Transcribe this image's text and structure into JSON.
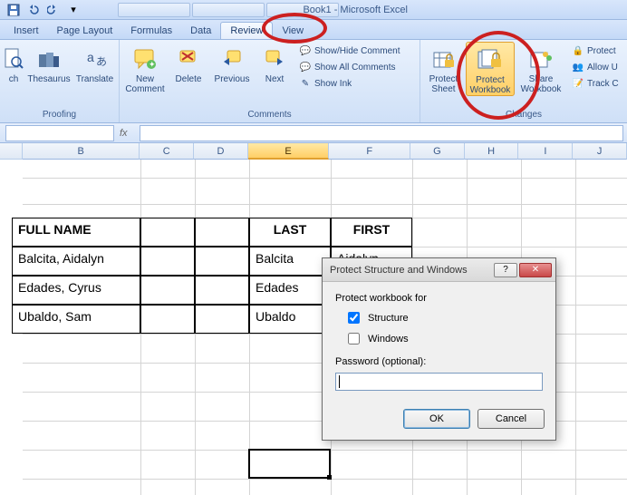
{
  "title": "Book1 - Microsoft Excel",
  "tabs": {
    "insert": "Insert",
    "page_layout": "Page Layout",
    "formulas": "Formulas",
    "data": "Data",
    "review": "Review",
    "view": "View"
  },
  "ribbon": {
    "proofing": {
      "title": "Proofing",
      "research": "ch",
      "thesaurus": "Thesaurus",
      "translate": "Translate"
    },
    "comments": {
      "title": "Comments",
      "new_comment": "New\nComment",
      "delete": "Delete",
      "previous": "Previous",
      "next": "Next",
      "show_hide": "Show/Hide Comment",
      "show_all": "Show All Comments",
      "show_ink": "Show Ink"
    },
    "changes": {
      "title": "Changes",
      "protect_sheet": "Protect\nSheet",
      "protect_workbook": "Protect\nWorkbook",
      "share_workbook": "Share\nWorkbook",
      "protect_share": "Protect",
      "allow_users": "Allow U",
      "track_changes": "Track C"
    }
  },
  "columns": [
    "B",
    "C",
    "D",
    "E",
    "F",
    "G",
    "H",
    "I",
    "J"
  ],
  "table": {
    "headers": {
      "fullname": "FULL NAME",
      "last": "LAST",
      "first": "FIRST"
    },
    "rows": [
      {
        "fullname": "Balcita, Aidalyn",
        "last": "Balcita",
        "first": "Aidalyn"
      },
      {
        "fullname": "Edades, Cyrus",
        "last": "Edades",
        "first": ""
      },
      {
        "fullname": "Ubaldo, Sam",
        "last": "Ubaldo",
        "first": ""
      }
    ]
  },
  "dialog": {
    "title": "Protect Structure and Windows",
    "label": "Protect workbook for",
    "structure": "Structure",
    "windows": "Windows",
    "password_label": "Password (optional):",
    "password_value": "",
    "ok": "OK",
    "cancel": "Cancel"
  },
  "formula_bar": {
    "fx": "fx",
    "name_value": "",
    "formula_value": ""
  }
}
